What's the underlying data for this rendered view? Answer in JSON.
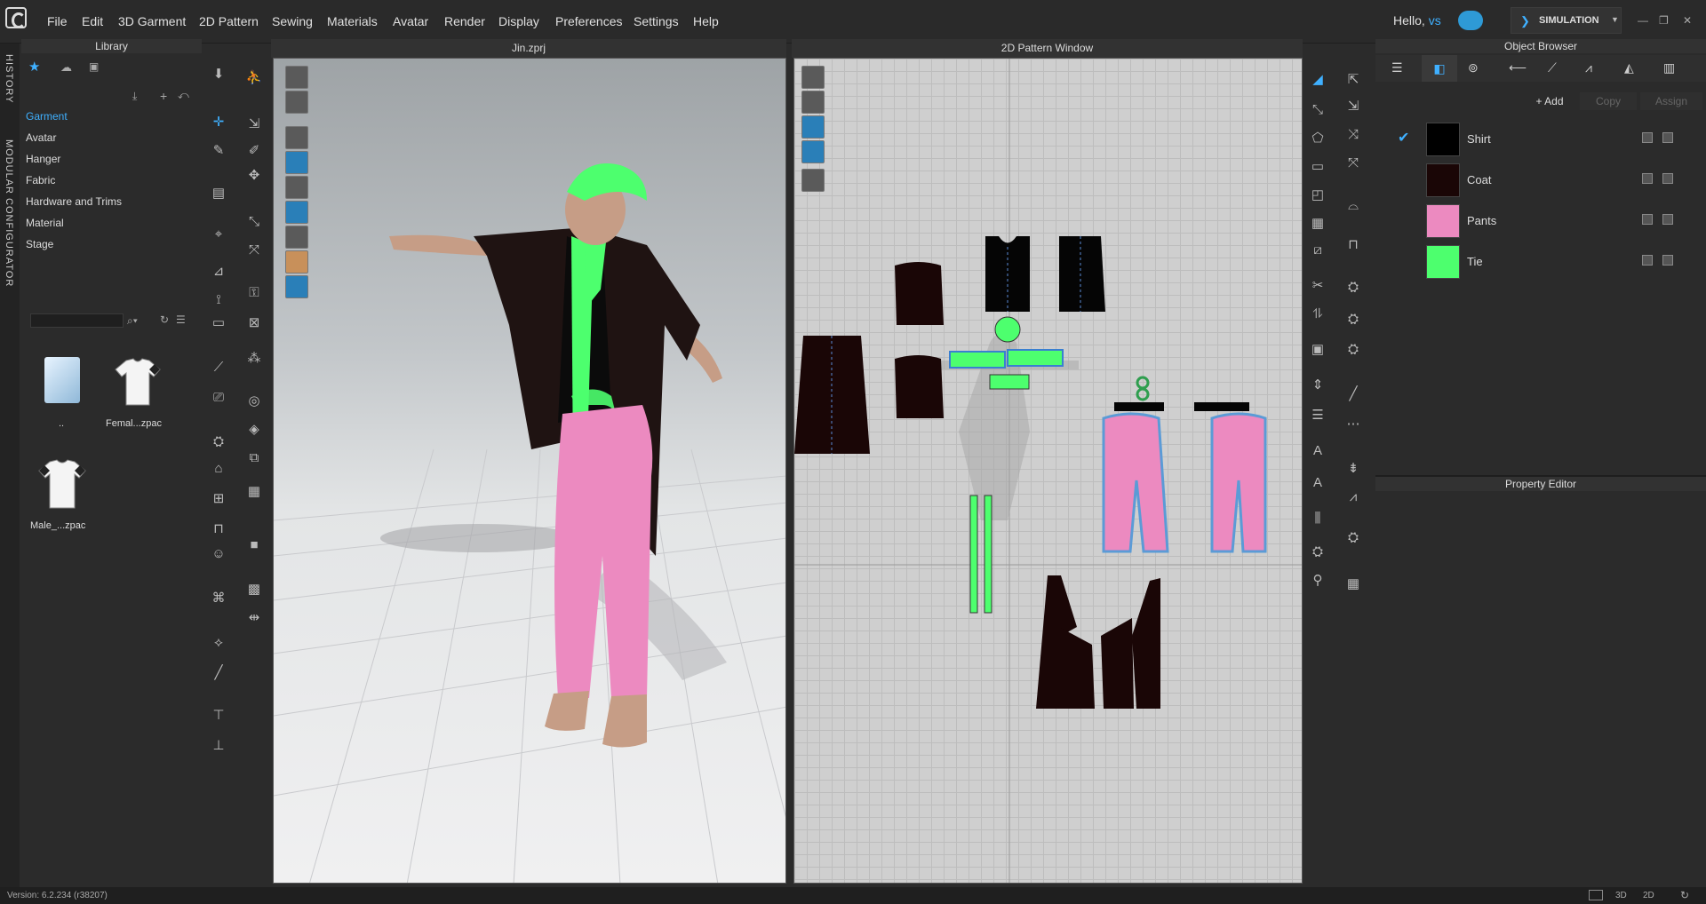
{
  "menu": [
    "File",
    "Edit",
    "3D Garment",
    "2D Pattern",
    "Sewing",
    "Materials",
    "Avatar",
    "Render",
    "Display",
    "Preferences",
    "Settings",
    "Help"
  ],
  "user": {
    "greeting": "Hello,",
    "name": "vs"
  },
  "simulation_label": "SIMULATION",
  "side_tabs": [
    "HISTORY",
    "MODULAR CONFIGURATOR"
  ],
  "library": {
    "title": "Library",
    "nav": [
      "Garment",
      "Avatar",
      "Hanger",
      "Fabric",
      "Hardware and Trims",
      "Material",
      "Stage"
    ],
    "files": [
      "..",
      "Femal...zpac",
      "Male_...zpac"
    ]
  },
  "viewport3d": {
    "title": "Jin.zprj"
  },
  "viewport2d": {
    "title": "2D Pattern Window"
  },
  "object_browser": {
    "title": "Object Browser",
    "actions": [
      "Add",
      "Copy",
      "Assign"
    ],
    "items": [
      {
        "name": "Shirt",
        "color": "#000000",
        "selected": true
      },
      {
        "name": "Coat",
        "color": "#1a0606",
        "selected": false
      },
      {
        "name": "Pants",
        "color": "#ec8ac0",
        "selected": false
      },
      {
        "name": "Tie",
        "color": "#4dff6e",
        "selected": false
      }
    ]
  },
  "property_editor": {
    "title": "Property Editor"
  },
  "status": {
    "version": "Version: 6.2.234 (r38207)",
    "view_modes": [
      "3D",
      "2D"
    ]
  }
}
